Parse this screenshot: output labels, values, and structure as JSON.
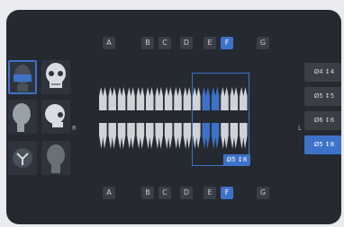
{
  "letters_top": [
    {
      "label": "A",
      "active": false
    },
    {
      "label": "B",
      "active": false
    },
    {
      "label": "C",
      "active": false
    },
    {
      "label": "D",
      "active": false
    },
    {
      "label": "E",
      "active": false
    },
    {
      "label": "F",
      "active": true
    },
    {
      "label": "G",
      "active": false
    }
  ],
  "letters_bottom": [
    {
      "label": "A",
      "active": false
    },
    {
      "label": "B",
      "active": false
    },
    {
      "label": "C",
      "active": false
    },
    {
      "label": "D",
      "active": false
    },
    {
      "label": "E",
      "active": false
    },
    {
      "label": "F",
      "active": true
    },
    {
      "label": "G",
      "active": false
    }
  ],
  "sides": {
    "right": "R",
    "left": "L"
  },
  "implant_sizes": [
    {
      "label": "Ø4 ↕4",
      "active": false
    },
    {
      "label": "Ø5 ↕5",
      "active": false
    },
    {
      "label": "Ø6 ↕6",
      "active": false
    },
    {
      "label": "Ø5 ↕8",
      "active": true
    }
  ],
  "selection": {
    "label": "Ø5 ↕8"
  },
  "views": [
    {
      "name": "view-panoramic-front",
      "active": true
    },
    {
      "name": "view-skull-front",
      "active": false
    },
    {
      "name": "view-head-side",
      "active": false
    },
    {
      "name": "view-skull-side",
      "active": false
    },
    {
      "name": "view-skull-bottom",
      "active": false
    },
    {
      "name": "view-head-back",
      "active": false
    }
  ],
  "colors": {
    "accent": "#3d72c9",
    "panel": "#252a31",
    "tooth": "#cfd3d8"
  },
  "teeth": {
    "upper_count": 16,
    "lower_count": 16,
    "selected_upper": [
      11,
      12
    ],
    "selected_lower": [
      11,
      12
    ]
  }
}
